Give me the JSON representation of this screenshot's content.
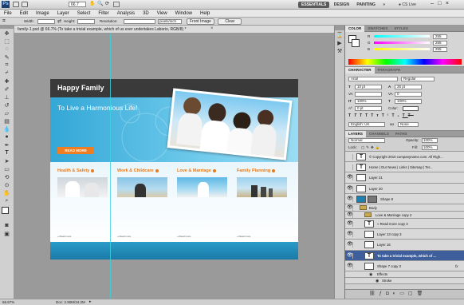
{
  "app": {
    "logo": "Ps",
    "workspaces": [
      "ESSENTIALS",
      "DESIGN",
      "PAINTING"
    ],
    "workspaces_more": "»",
    "cs_live": "CS Live",
    "window_controls": [
      "–",
      "□",
      "×"
    ],
    "zoom_display": "66.7"
  },
  "menu": [
    "File",
    "Edit",
    "Image",
    "Layer",
    "Select",
    "Filter",
    "Analysis",
    "3D",
    "View",
    "Window",
    "Help"
  ],
  "options": {
    "width_label": "Width:",
    "height_label": "Height:",
    "resolution_label": "Resolution:",
    "unit": "pixels/inch",
    "front_image": "Front Image",
    "clear": "Clear"
  },
  "document": {
    "tab_title": "family-1.psd @ 66.7% (To take a trivial example, which of us ever undertakes  Laborio, RGB/8) *"
  },
  "site": {
    "brand": "Happy Family",
    "hero_text": "To Live a Harmonious Life!",
    "read_more": "READ MORE",
    "columns": [
      {
        "heading": "Health & Safety",
        "more": "» Read more"
      },
      {
        "heading": "Work & Childcare",
        "more": "» Read more"
      },
      {
        "heading": "Love & Marriage",
        "more": "» Read more"
      },
      {
        "heading": "Family Planning",
        "more": "» Read more"
      }
    ]
  },
  "status": {
    "zoom": "66.67%",
    "doc": "Doc: 2.90M/34.2M"
  },
  "color_panel": {
    "tabs": [
      "COLOR",
      "SWATCHES",
      "STYLES"
    ],
    "channels": [
      {
        "label": "R",
        "value": "255"
      },
      {
        "label": "G",
        "value": "255"
      },
      {
        "label": "B",
        "value": "255"
      }
    ]
  },
  "character_panel": {
    "tabs": [
      "CHARACTER",
      "PARAGRAPH"
    ],
    "font": "Arial",
    "style": "Regular",
    "size": "10 pt",
    "leading": "26 pt",
    "tracking": "0",
    "vscale": "100%",
    "hscale": "100%",
    "baseline": "0 pt",
    "color_label": "Color:",
    "language": "English: UK",
    "aa": "None",
    "aa_label": "aɑ"
  },
  "layers_panel": {
    "tabs": [
      "LAYERS",
      "CHANNELS",
      "PATHS"
    ],
    "blend": "Normal",
    "opacity_label": "Opacity:",
    "opacity": "100%",
    "fill_label": "Fill:",
    "fill": "100%",
    "lock_label": "Lock:",
    "layers": [
      {
        "name": "© Copyright 2010 companyname.com. All Righ...",
        "type": "text",
        "selected": false
      },
      {
        "name": "Home  |  Our News  |  Links  |  Sitemap  |  Ter...",
        "type": "text",
        "selected": false
      },
      {
        "name": "Layer 21",
        "type": "pixel",
        "selected": false
      },
      {
        "name": "Layer 20",
        "type": "pixel",
        "selected": false
      },
      {
        "name": "Shape 8",
        "type": "shape",
        "selected": false
      },
      {
        "name": "Body",
        "type": "folder",
        "selected": false
      },
      {
        "name": "Love & Marriage copy 2",
        "type": "folder",
        "selected": false
      },
      {
        "name": "» Read more copy 3",
        "type": "text",
        "selected": false
      },
      {
        "name": "Layer 13 copy 3",
        "type": "pixel",
        "selected": false
      },
      {
        "name": "Layer 16",
        "type": "pixel",
        "selected": false
      },
      {
        "name": "To take a trivial example, which of ...",
        "type": "text",
        "selected": true
      },
      {
        "name": "Shape 7 copy 3",
        "type": "shape",
        "selected": false
      },
      {
        "name": "Effects",
        "type": "effect",
        "selected": false
      },
      {
        "name": "Stroke",
        "type": "effect",
        "selected": false
      }
    ],
    "fx": "fx"
  }
}
